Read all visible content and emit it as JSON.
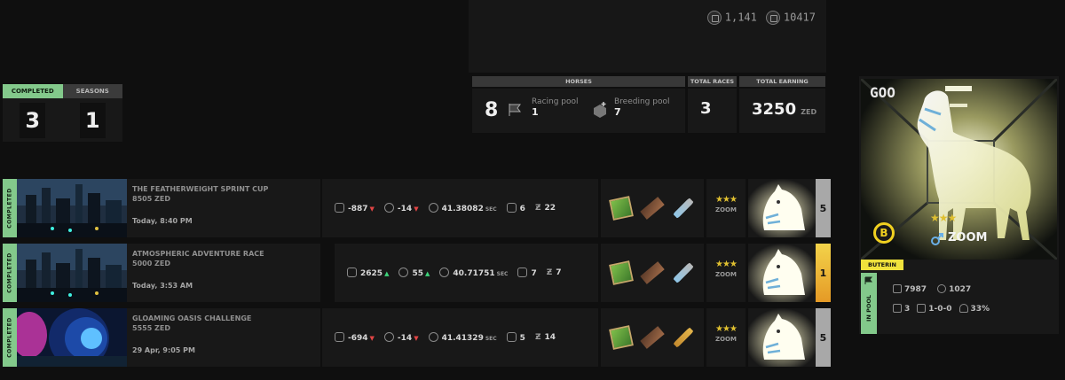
{
  "wallet": {
    "zed_balance": "1,141",
    "rz_balance": "10417"
  },
  "summary": {
    "tabs": [
      "COMPLETED",
      "SEASONS"
    ],
    "completed": "3",
    "seasons": "1"
  },
  "stats": {
    "horses_header": "HORSES",
    "total_races_header": "TOTAL RACES",
    "total_earning_header": "TOTAL EARNING",
    "horses_count": "8",
    "racing_pool_label": "Racing pool",
    "racing_pool_value": "1",
    "breeding_pool_label": "Breeding pool",
    "breeding_pool_value": "7",
    "total_races": "3",
    "total_earning": "3250",
    "earning_unit": "ZED"
  },
  "races": [
    {
      "status": "COMPLETED",
      "name": "THE FEATHERWEIGHT SPRINT CUP",
      "prize": "8505 ZED",
      "time": "Today, 8:40 PM",
      "zed_delta": "-887",
      "zed_trend": "down",
      "rating_delta": "-14",
      "rating_trend": "down",
      "race_time": "41.38082",
      "time_unit": "SEC",
      "gate": "6",
      "distance": "22",
      "stars": "★★★",
      "horse_name": "ZOOM",
      "place": "5",
      "items": [
        "map",
        "scroll",
        "rod"
      ],
      "thumb_theme": "city"
    },
    {
      "status": "COMPLETED",
      "name": "ATMOSPHERIC ADVENTURE RACE",
      "prize": "5000 ZED",
      "time": "Today, 3:53 AM",
      "zed_delta": "2625",
      "zed_trend": "up",
      "rating_delta": "55",
      "rating_trend": "up",
      "race_time": "40.71751",
      "time_unit": "SEC",
      "gate": "7",
      "distance": "7",
      "stars": "★★★",
      "horse_name": "ZOOM",
      "place": "1",
      "items": [
        "map",
        "scroll",
        "rod"
      ],
      "thumb_theme": "city"
    },
    {
      "status": "COMPLETED",
      "name": "GLOAMING OASIS CHALLENGE",
      "prize": "5555 ZED",
      "time": "29 Apr, 9:05 PM",
      "zed_delta": "-694",
      "zed_trend": "down",
      "rating_delta": "-14",
      "rating_trend": "down",
      "race_time": "41.41329",
      "time_unit": "SEC",
      "gate": "5",
      "distance": "14",
      "stars": "★★★",
      "horse_name": "ZOOM",
      "place": "5",
      "items": [
        "map",
        "scroll",
        "flute"
      ],
      "thumb_theme": "tunnel"
    }
  ],
  "horse_card": {
    "brand": "GOO",
    "badge": "B",
    "stars": "★★★",
    "gender_icon": "male-female-icon",
    "name": "ZOOM",
    "owner": "BUTERIN",
    "status": "IN POOL",
    "zed_stat": "7987",
    "rating_stat": "1027",
    "races": "3",
    "record": "1-0-0",
    "win_rate": "33%"
  },
  "colors": {
    "status_green": "#83c98b",
    "star_gold": "#e0c030",
    "down_red": "#e14545",
    "up_green": "#3ed37b",
    "owner_yellow": "#f0e23c"
  }
}
